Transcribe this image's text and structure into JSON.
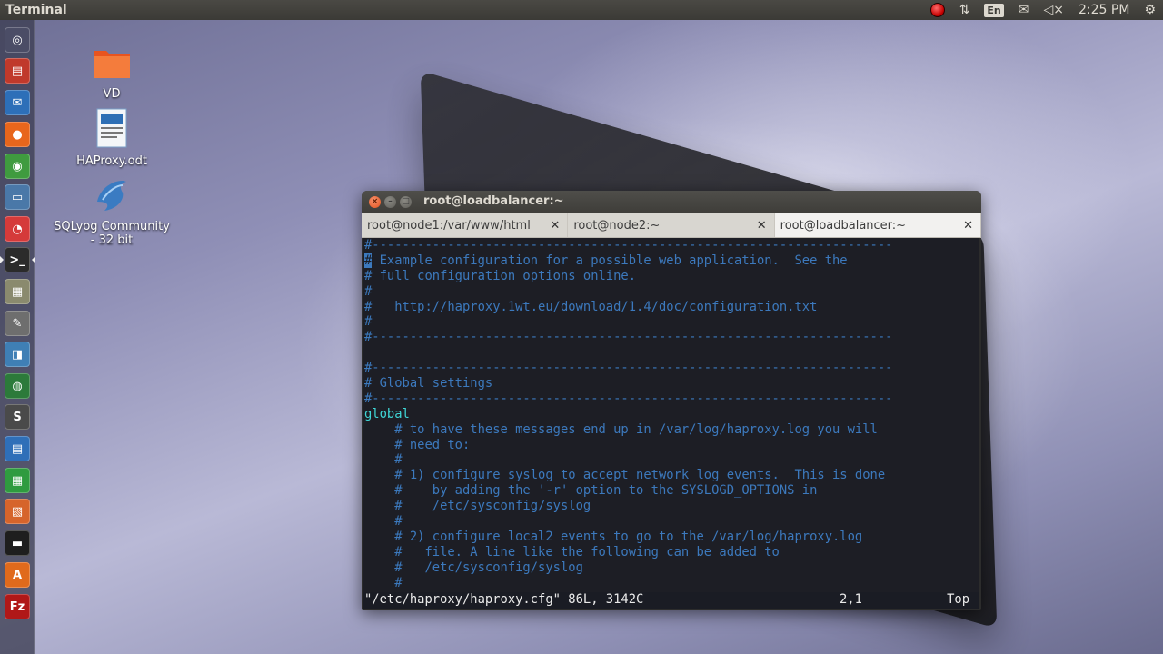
{
  "top_panel": {
    "app_title": "Terminal",
    "language": "En",
    "clock": "2:25 PM"
  },
  "launcher": {
    "items": [
      {
        "name": "dash-icon",
        "glyph": "◎",
        "color": "#4b4d66"
      },
      {
        "name": "files-manager-icon",
        "glyph": "▤",
        "color": "#c0392b"
      },
      {
        "name": "thunderbird-icon",
        "glyph": "✉",
        "color": "#2d6fb8"
      },
      {
        "name": "firefox-icon",
        "glyph": "●",
        "color": "#e8661c"
      },
      {
        "name": "chrome-icon",
        "glyph": "◉",
        "color": "#3f9b3f"
      },
      {
        "name": "remote-desktop-icon",
        "glyph": "▭",
        "color": "#4a78a8"
      },
      {
        "name": "red-app-icon",
        "glyph": "◔",
        "color": "#d53a3a"
      },
      {
        "name": "terminal-icon",
        "glyph": ">_",
        "color": "#2b2b2b"
      },
      {
        "name": "image-viewer-icon",
        "glyph": "▦",
        "color": "#8a8a6e"
      },
      {
        "name": "text-editor-icon",
        "glyph": "✎",
        "color": "#6e6e6e"
      },
      {
        "name": "drawing-icon",
        "glyph": "◨",
        "color": "#3f7fb5"
      },
      {
        "name": "globe-icon",
        "glyph": "◍",
        "color": "#2c7a3a"
      },
      {
        "name": "sublime-icon",
        "glyph": "S",
        "color": "#4a4a4a"
      },
      {
        "name": "writer-icon",
        "glyph": "▤",
        "color": "#2f6fb8"
      },
      {
        "name": "calc-icon",
        "glyph": "▦",
        "color": "#2f9b3f"
      },
      {
        "name": "impress-icon",
        "glyph": "▧",
        "color": "#d6642b"
      },
      {
        "name": "app-stripe-icon",
        "glyph": "▬",
        "color": "#1e1e1e"
      },
      {
        "name": "software-center-icon",
        "glyph": "A",
        "color": "#e06a1c"
      },
      {
        "name": "filezilla-icon",
        "glyph": "Fz",
        "color": "#b01818"
      }
    ]
  },
  "desktop": {
    "icons": [
      {
        "label": "VD",
        "type": "folder"
      },
      {
        "label": "HAProxy.odt",
        "type": "document"
      },
      {
        "label": "SQLyog Community - 32 bit",
        "type": "dolphin"
      }
    ]
  },
  "terminal": {
    "window_title": "root@loadbalancer:~",
    "tabs": [
      {
        "label": "root@node1:/var/www/html",
        "active": false
      },
      {
        "label": "root@node2:~",
        "active": false
      },
      {
        "label": "root@loadbalancer:~",
        "active": true
      }
    ],
    "lines": [
      "#---------------------------------------------------------------------",
      "# Example configuration for a possible web application.  See the",
      "# full configuration options online.",
      "#",
      "#   http://haproxy.1wt.eu/download/1.4/doc/configuration.txt",
      "#",
      "#---------------------------------------------------------------------",
      "",
      "#---------------------------------------------------------------------",
      "# Global settings",
      "#---------------------------------------------------------------------",
      "global",
      "    # to have these messages end up in /var/log/haproxy.log you will",
      "    # need to:",
      "    #",
      "    # 1) configure syslog to accept network log events.  This is done",
      "    #    by adding the '-r' option to the SYSLOGD_OPTIONS in",
      "    #    /etc/sysconfig/syslog",
      "    #",
      "    # 2) configure local2 events to go to the /var/log/haproxy.log",
      "    #   file. A line like the following can be added to",
      "    #   /etc/sysconfig/syslog",
      "    #"
    ],
    "status": {
      "file": "\"/etc/haproxy/haproxy.cfg\" 86L, 3142C",
      "position": "2,1",
      "scroll": "Top"
    }
  }
}
